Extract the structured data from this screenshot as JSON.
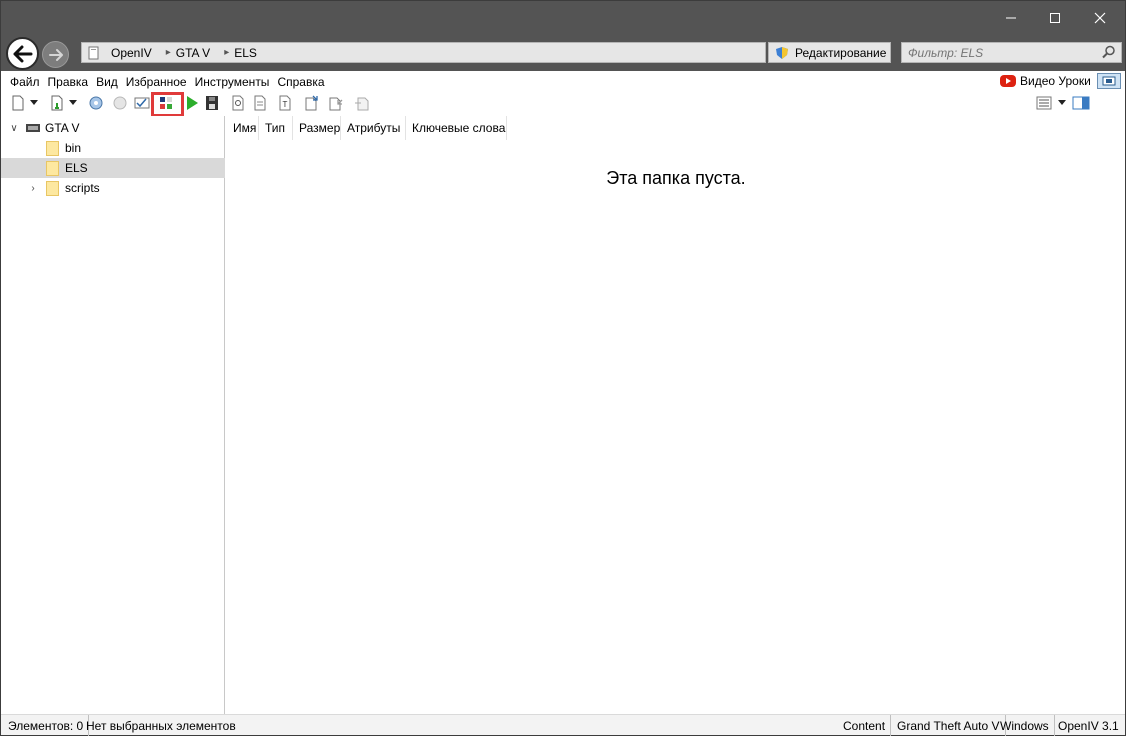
{
  "breadcrumb": [
    "OpenIV",
    "GTA V",
    "ELS"
  ],
  "edit_button": "Редактирование",
  "filter": {
    "placeholder": "Фильтр: ELS"
  },
  "menu": [
    "Файл",
    "Правка",
    "Вид",
    "Избранное",
    "Инструменты",
    "Справка"
  ],
  "video_link": "Видео Уроки",
  "tree": {
    "root": "GTA V",
    "children": [
      {
        "label": "bin",
        "expandable": false,
        "selected": false
      },
      {
        "label": "ELS",
        "expandable": false,
        "selected": true
      },
      {
        "label": "scripts",
        "expandable": true,
        "selected": false
      }
    ]
  },
  "columns": [
    "Имя",
    "Тип",
    "Размер",
    "Атрибуты",
    "Ключевые слова"
  ],
  "empty_message": "Эта папка пуста.",
  "status": {
    "items_count": "Элементов: 0",
    "selection": "Нет выбранных элементов",
    "content": "Content",
    "game": "Grand Theft Auto V",
    "platform": "Windows",
    "version": "OpenIV 3.1"
  },
  "colors": {
    "titlebar": "#545454",
    "highlight": "#e03a3a",
    "selected_row": "#d9d9d9",
    "folder": "#fde8a0"
  },
  "icons": {
    "toolbar": [
      "new-file-icon",
      "dropdown-arrow-icon",
      "new-import-icon",
      "dropdown-arrow-icon",
      "settings-gear-icon",
      "settings-disabled-icon",
      "checklist-icon",
      "color-palette-icon",
      "play-icon",
      "save-icon",
      "search-file-icon",
      "document-icon",
      "text-file-icon",
      "export-icon",
      "import-icon",
      "replace-icon"
    ],
    "view": [
      "details-view-icon",
      "dropdown-arrow-icon",
      "preview-pane-icon"
    ]
  }
}
